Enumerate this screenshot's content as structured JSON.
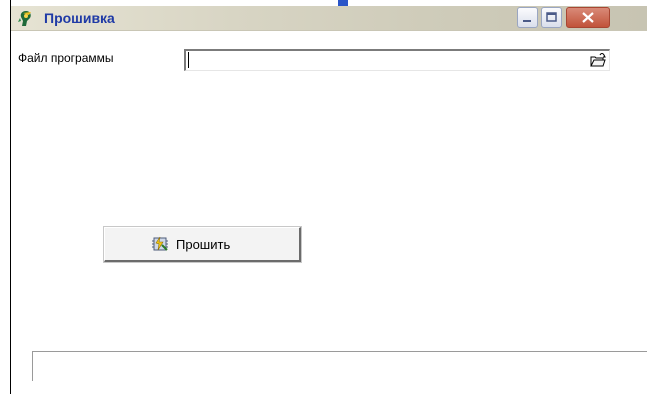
{
  "window": {
    "title": "Прошивка",
    "buttons": {
      "minimize_icon": "minimize-icon",
      "maximize_icon": "maximize-icon",
      "close_icon": "close-icon"
    }
  },
  "form": {
    "file_label": "Файл программы",
    "file_value": "",
    "open_icon": "folder-open-icon"
  },
  "actions": {
    "flash_label": "Прошить",
    "flash_icon": "flash-chip-icon"
  },
  "status": {
    "text": ""
  },
  "colors": {
    "title_text": "#1f3aa6",
    "close_button": "#c1533a"
  }
}
